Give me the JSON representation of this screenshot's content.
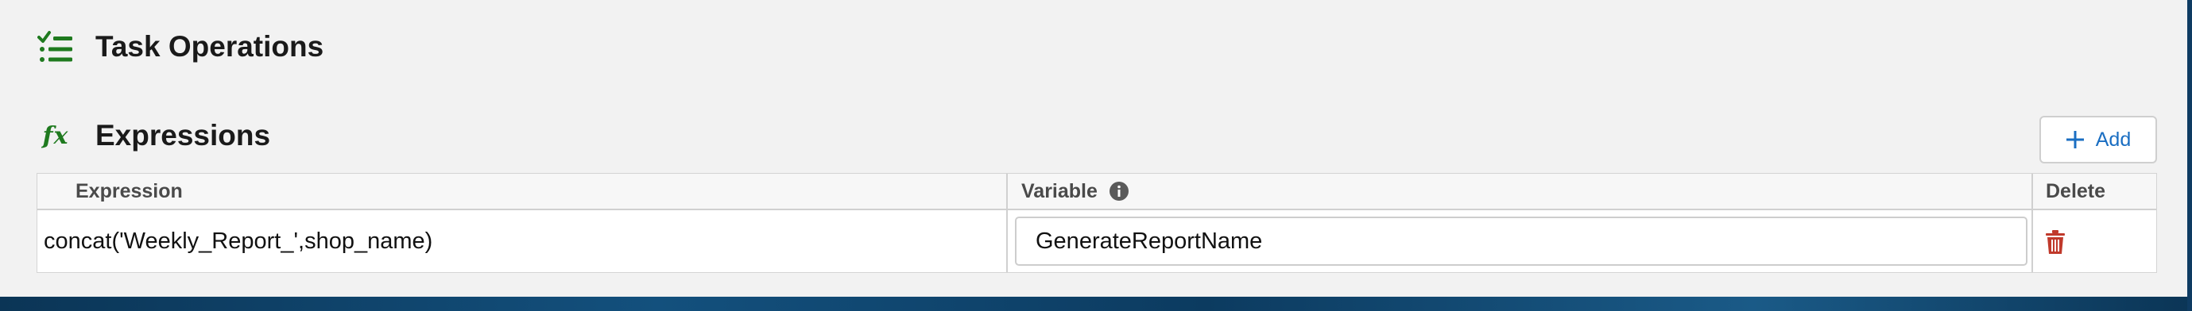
{
  "task_section": {
    "title": "Task Operations",
    "icon": "checklist-icon",
    "accent": "#1f7a1f"
  },
  "expressions_section": {
    "title": "Expressions",
    "icon": "function-fx-icon",
    "icon_glyph": "fx",
    "add_button": {
      "label": "Add",
      "icon": "plus-icon",
      "color": "#1a6ec2"
    },
    "table": {
      "columns": {
        "expression": "Expression",
        "variable": "Variable",
        "delete": "Delete"
      },
      "variable_info_icon": "info-icon",
      "rows": [
        {
          "expression": "concat('Weekly_Report_',shop_name)",
          "variable": "GenerateReportName",
          "delete_icon": "trash-icon",
          "delete_color": "#c0392b"
        }
      ]
    }
  }
}
